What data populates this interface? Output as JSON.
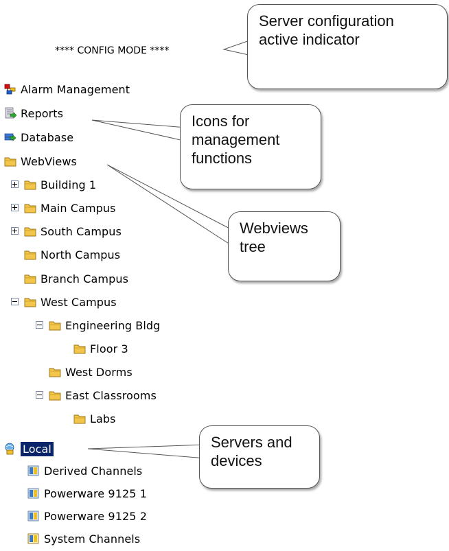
{
  "config_mode": "**** CONFIG MODE ****",
  "management": [
    {
      "label": "Alarm Management",
      "icon": "alarm-icon"
    },
    {
      "label": "Reports",
      "icon": "reports-icon"
    },
    {
      "label": "Database",
      "icon": "database-icon"
    }
  ],
  "webviews": {
    "label": "WebViews",
    "items": [
      {
        "label": "Building 1",
        "expander": "plus"
      },
      {
        "label": "Main Campus",
        "expander": "plus"
      },
      {
        "label": "South Campus",
        "expander": "plus"
      },
      {
        "label": "North Campus"
      },
      {
        "label": "Branch Campus"
      },
      {
        "label": "West Campus",
        "expander": "minus"
      },
      {
        "label": "Engineering Bldg",
        "expander": "minus"
      },
      {
        "label": "Floor 3"
      },
      {
        "label": "West Dorms"
      },
      {
        "label": "East Classrooms",
        "expander": "minus"
      },
      {
        "label": "Labs"
      }
    ]
  },
  "servers": {
    "label": "Local",
    "devices": [
      {
        "label": "Derived Channels"
      },
      {
        "label": "Powerware 9125 1"
      },
      {
        "label": "Powerware 9125 2"
      },
      {
        "label": "System Channels"
      }
    ]
  },
  "callouts": {
    "server": "Server configuration active indicator",
    "icons": "Icons for management functions",
    "webviews": "Webviews tree",
    "servers": "Servers and devices"
  },
  "colors": {
    "selection": "#0a246a",
    "folder": "#f2c64a",
    "device": "#3a78c8"
  }
}
